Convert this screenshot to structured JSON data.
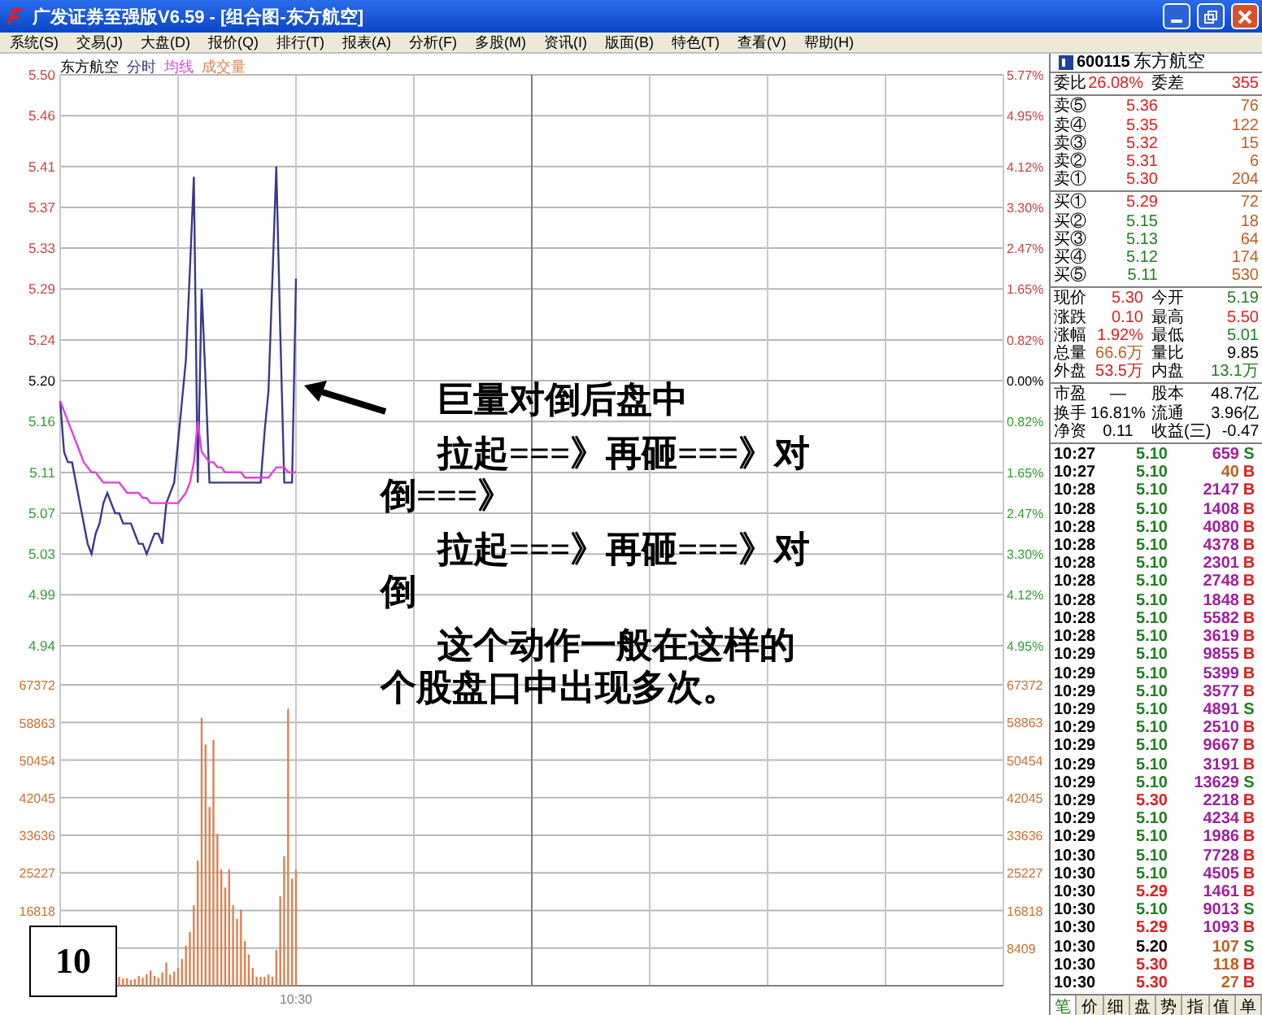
{
  "window": {
    "title": "广发证券至强版V6.59 - [组合图-东方航空]"
  },
  "menu": [
    "系统(S)",
    "交易(J)",
    "大盘(D)",
    "报价(Q)",
    "排行(T)",
    "报表(A)",
    "分析(F)",
    "多股(M)",
    "资讯(I)",
    "版面(B)",
    "特色(T)",
    "查看(V)",
    "帮助(H)"
  ],
  "chart": {
    "stock_label": "东方航空",
    "price_chart": {
      "chart_data": {
        "type": "line",
        "grid": true,
        "ylim": [
          4.94,
          5.5
        ],
        "yticks": [
          {
            "value": 5.5,
            "label": "5.50"
          },
          {
            "value": 5.46,
            "label": "5.46"
          },
          {
            "value": 5.41,
            "label": "5.41"
          },
          {
            "value": 5.37,
            "label": "5.37"
          },
          {
            "value": 5.33,
            "label": "5.33"
          },
          {
            "value": 5.29,
            "label": "5.29"
          },
          {
            "value": 5.24,
            "label": "5.24"
          },
          {
            "value": 5.2,
            "label": "5.20"
          },
          {
            "value": 5.16,
            "label": "5.16"
          },
          {
            "value": 5.11,
            "label": "5.11"
          },
          {
            "value": 5.07,
            "label": "5.07"
          },
          {
            "value": 5.03,
            "label": "5.03"
          },
          {
            "value": 4.99,
            "label": "4.99"
          },
          {
            "value": 4.94,
            "label": "4.94"
          }
        ],
        "categories": [
          null,
          null,
          null,
          null,
          null,
          null,
          null,
          null,
          null,
          null,
          null,
          null,
          null,
          null,
          null,
          null,
          null,
          null,
          null,
          null,
          null,
          null,
          null,
          null,
          null,
          null,
          null,
          null,
          null,
          null,
          null,
          null,
          null,
          null,
          null,
          null,
          null,
          null,
          null,
          null,
          null,
          null,
          null,
          null,
          null,
          null,
          null,
          null,
          null,
          null,
          null,
          null,
          null,
          null,
          null,
          null,
          null,
          null,
          null,
          null,
          null,
          null,
          null,
          null,
          null,
          null,
          null,
          null,
          null,
          null,
          null,
          null,
          null,
          null,
          null,
          null,
          null,
          null,
          null,
          null,
          null,
          null,
          null,
          null,
          null,
          null,
          null,
          null,
          null,
          null,
          null,
          null,
          null,
          null,
          null,
          null,
          null,
          null,
          null,
          null,
          null,
          null,
          null,
          null,
          null,
          null,
          null,
          null,
          null,
          null,
          null,
          null,
          null,
          null,
          null,
          null,
          null,
          null,
          null,
          null,
          null,
          null,
          null,
          null,
          null,
          null,
          null,
          null,
          null,
          null,
          null,
          null,
          null,
          null,
          null,
          null,
          null,
          null,
          null,
          null,
          null,
          null,
          null,
          null,
          null,
          null,
          null,
          null,
          null,
          null,
          null,
          null,
          null,
          null,
          null,
          null,
          null,
          null,
          null,
          null,
          null,
          null,
          null,
          null,
          null,
          null,
          null,
          null,
          null,
          null,
          null,
          null,
          null,
          null,
          null,
          null,
          null,
          null,
          null,
          null,
          null,
          null,
          null,
          null,
          null,
          null,
          null,
          null,
          null,
          null,
          null,
          null,
          null,
          null,
          null,
          null,
          null,
          null,
          null,
          null,
          null,
          null,
          null,
          null,
          null,
          null,
          null,
          null,
          null,
          null,
          null,
          null,
          null,
          null,
          null,
          null,
          null,
          null,
          null,
          null,
          null,
          null,
          null,
          null,
          null,
          null,
          null,
          null,
          null,
          null,
          null,
          null,
          null,
          null,
          null,
          null,
          null,
          null,
          null,
          null,
          null
        ],
        "series": [
          {
            "name": "分时",
            "color": "#3a3a8c",
            "values": [
              5.18,
              5.13,
              5.12,
              5.12,
              5.1,
              5.08,
              5.06,
              5.04,
              5.03,
              5.05,
              5.06,
              5.08,
              5.09,
              5.08,
              5.07,
              5.07,
              5.06,
              5.06,
              5.06,
              5.05,
              5.04,
              5.04,
              5.03,
              5.04,
              5.05,
              5.05,
              5.04,
              5.08,
              5.09,
              5.1,
              5.14,
              5.18,
              5.22,
              5.31,
              5.4,
              5.1,
              5.29,
              5.2,
              5.1,
              5.1,
              5.1,
              5.1,
              5.1,
              5.1,
              5.1,
              5.1,
              5.1,
              5.1,
              5.1,
              5.1,
              5.1,
              5.1,
              5.15,
              5.19,
              5.3,
              5.41,
              5.25,
              5.1,
              5.1,
              5.1,
              5.3,
              null,
              null,
              null,
              null,
              null,
              null,
              null,
              null,
              null,
              null,
              null,
              null,
              null,
              null,
              null,
              null,
              null,
              null,
              null,
              null,
              null,
              null,
              null,
              null,
              null,
              null,
              null,
              null,
              null,
              null,
              null,
              null,
              null,
              null,
              null,
              null,
              null,
              null,
              null,
              null,
              null,
              null,
              null,
              null,
              null,
              null,
              null,
              null,
              null,
              null,
              null,
              null,
              null,
              null,
              null,
              null,
              null,
              null,
              null,
              null,
              null,
              null,
              null,
              null,
              null,
              null,
              null,
              null,
              null,
              null,
              null,
              null,
              null,
              null,
              null,
              null,
              null,
              null,
              null,
              null,
              null,
              null,
              null,
              null,
              null,
              null,
              null,
              null,
              null,
              null,
              null,
              null,
              null,
              null,
              null,
              null,
              null,
              null,
              null,
              null,
              null,
              null,
              null,
              null,
              null,
              null,
              null,
              null,
              null,
              null,
              null,
              null,
              null,
              null,
              null,
              null,
              null,
              null,
              null,
              null,
              null,
              null,
              null,
              null,
              null,
              null,
              null,
              null,
              null,
              null,
              null,
              null,
              null,
              null,
              null,
              null,
              null,
              null,
              null,
              null,
              null,
              null,
              null,
              null,
              null,
              null,
              null,
              null,
              null,
              null,
              null,
              null,
              null,
              null,
              null,
              null,
              null,
              null,
              null,
              null,
              null,
              null,
              null,
              null,
              null,
              null,
              null,
              null,
              null,
              null,
              null,
              null,
              null,
              null,
              null,
              null,
              null,
              null,
              null,
              null
            ]
          },
          {
            "name": "均线",
            "color": "#e040e0",
            "values": [
              5.18,
              5.17,
              5.16,
              5.15,
              5.14,
              5.13,
              5.12,
              5.115,
              5.11,
              5.11,
              5.105,
              5.1,
              5.1,
              5.1,
              5.1,
              5.1,
              5.095,
              5.09,
              5.09,
              5.09,
              5.09,
              5.085,
              5.085,
              5.08,
              5.08,
              5.08,
              5.08,
              5.08,
              5.08,
              5.08,
              5.08,
              5.085,
              5.09,
              5.1,
              5.12,
              5.16,
              5.13,
              5.125,
              5.12,
              5.12,
              5.115,
              5.115,
              5.11,
              5.11,
              5.11,
              5.11,
              5.11,
              5.105,
              5.105,
              5.105,
              5.105,
              5.105,
              5.105,
              5.105,
              5.11,
              5.115,
              5.115,
              5.115,
              5.11,
              5.11,
              5.11,
              null,
              null,
              null,
              null,
              null,
              null,
              null,
              null,
              null,
              null,
              null,
              null,
              null,
              null,
              null,
              null,
              null,
              null,
              null,
              null,
              null,
              null,
              null,
              null,
              null,
              null,
              null,
              null,
              null,
              null,
              null,
              null,
              null,
              null,
              null,
              null,
              null,
              null,
              null,
              null,
              null,
              null,
              null,
              null,
              null,
              null,
              null,
              null,
              null,
              null,
              null,
              null,
              null,
              null,
              null,
              null,
              null,
              null,
              null,
              null,
              null,
              null,
              null,
              null,
              null,
              null,
              null,
              null,
              null,
              null,
              null,
              null,
              null,
              null,
              null,
              null,
              null,
              null,
              null,
              null,
              null,
              null,
              null,
              null,
              null,
              null,
              null,
              null,
              null,
              null,
              null,
              null,
              null,
              null,
              null,
              null,
              null,
              null,
              null,
              null,
              null,
              null,
              null,
              null,
              null,
              null,
              null,
              null,
              null,
              null,
              null,
              null,
              null,
              null,
              null,
              null,
              null,
              null,
              null,
              null,
              null,
              null,
              null,
              null,
              null,
              null,
              null,
              null,
              null,
              null,
              null,
              null,
              null,
              null,
              null,
              null,
              null,
              null,
              null,
              null,
              null,
              null,
              null,
              null,
              null,
              null,
              null,
              null,
              null,
              null,
              null,
              null,
              null,
              null,
              null,
              null,
              null,
              null,
              null,
              null,
              null,
              null,
              null,
              null,
              null,
              null,
              null,
              null,
              null,
              null,
              null,
              null,
              null,
              null,
              null,
              null,
              null,
              null,
              null,
              null
            ]
          }
        ]
      },
      "right_axis_labels": [
        {
          "text": "5.77%",
          "color": "#d04040"
        },
        {
          "text": "4.95%",
          "color": "#d04040"
        },
        {
          "text": "4.12%",
          "color": "#d04040"
        },
        {
          "text": "3.30%",
          "color": "#d04040"
        },
        {
          "text": "2.47%",
          "color": "#d04040"
        },
        {
          "text": "1.65%",
          "color": "#d04040"
        },
        {
          "text": "0.82%",
          "color": "#d04040"
        },
        {
          "text": "0.00%",
          "color": "#000000"
        },
        {
          "text": "0.82%",
          "color": "#30a030"
        },
        {
          "text": "1.65%",
          "color": "#30a030"
        },
        {
          "text": "2.47%",
          "color": "#30a030"
        },
        {
          "text": "3.30%",
          "color": "#30a030"
        },
        {
          "text": "4.12%",
          "color": "#30a030"
        },
        {
          "text": "4.95%",
          "color": "#30a030"
        }
      ]
    },
    "volume_chart": {
      "chart_data": {
        "type": "bar",
        "grid": true,
        "ylim": [
          0,
          67372
        ],
        "yticks": [
          {
            "value": 67372,
            "label": "67372"
          },
          {
            "value": 58863,
            "label": "58863"
          },
          {
            "value": 50454,
            "label": "50454"
          },
          {
            "value": 42045,
            "label": "42045"
          },
          {
            "value": 33636,
            "label": "33636"
          },
          {
            "value": 25227,
            "label": "25227"
          },
          {
            "value": 16818,
            "label": "16818"
          }
        ],
        "categories": [
          null,
          null,
          null,
          null,
          null,
          null,
          null,
          null,
          null,
          null,
          null,
          null,
          null,
          null,
          null,
          null,
          null,
          null,
          null,
          null,
          null,
          null,
          null,
          null,
          null,
          null,
          null,
          null,
          null,
          null,
          null,
          null,
          null,
          null,
          null,
          null,
          null,
          null,
          null,
          null,
          null,
          null,
          null,
          null,
          null,
          null,
          null,
          null,
          null,
          null,
          null,
          null,
          null,
          null,
          null,
          null,
          null,
          null,
          null,
          null,
          "10:30",
          null,
          null,
          null,
          null,
          null,
          null,
          null,
          null,
          null,
          null,
          null,
          null,
          null,
          null,
          null,
          null,
          null,
          null,
          null,
          null,
          null,
          null,
          null,
          null,
          null,
          null,
          null,
          null,
          null,
          null,
          null,
          null,
          null,
          null,
          null,
          null,
          null,
          null,
          null,
          null,
          null,
          null,
          null,
          null,
          null,
          null,
          null,
          null,
          null,
          null,
          null,
          null,
          null,
          null,
          null,
          null,
          null,
          null,
          null,
          null,
          null,
          null,
          null,
          null,
          null,
          null,
          null,
          null,
          null,
          null,
          null,
          null,
          null,
          null,
          null,
          null,
          null,
          null,
          null,
          null,
          null,
          null,
          null,
          null,
          null,
          null,
          null,
          null,
          null,
          null,
          null,
          null,
          null,
          null,
          null,
          null,
          null,
          null,
          null,
          null,
          null,
          null,
          null,
          null,
          null,
          null,
          null,
          null,
          null,
          null,
          null,
          null,
          null,
          null,
          null,
          null,
          null,
          null,
          null,
          null,
          null,
          null,
          null,
          null,
          null,
          null,
          null,
          null,
          null,
          null,
          null,
          null,
          null,
          null,
          null,
          null,
          null,
          null,
          null,
          null,
          null,
          null,
          null,
          null,
          null,
          null,
          null,
          null,
          null,
          null,
          null,
          null,
          null,
          null,
          null,
          null,
          null,
          null,
          null,
          null,
          null,
          null,
          null,
          null,
          null,
          null,
          null,
          null,
          null,
          null,
          null,
          null,
          null,
          null,
          null,
          null,
          null,
          null,
          null,
          null
        ],
        "series": [
          {
            "name": "成交量",
            "color": "#e08050",
            "values": [
              null,
              null,
              null,
              null,
              null,
              null,
              null,
              null,
              null,
              null,
              null,
              null,
              null,
              null,
              null,
              2000,
              1600,
              1700,
              1300,
              1500,
              2200,
              1800,
              2600,
              3400,
              2200,
              1800,
              3000,
              5200,
              2500,
              3200,
              4000,
              6000,
              9000,
              12000,
              18000,
              28000,
              60000,
              54000,
              40000,
              55000,
              34000,
              26000,
              22000,
              26000,
              18000,
              15000,
              17000,
              10000,
              7000,
              4000,
              2000,
              2000,
              2000,
              2500,
              2000,
              8000,
              20000,
              29000,
              62000,
              24000,
              26000,
              null,
              null,
              null,
              null,
              null,
              null,
              null,
              null,
              null,
              null,
              null,
              null,
              null,
              null,
              null,
              null,
              null,
              null,
              null,
              null,
              null,
              null,
              null,
              null,
              null,
              null,
              null,
              null,
              null,
              null,
              null,
              null,
              null,
              null,
              null,
              null,
              null,
              null,
              null,
              null,
              null,
              null,
              null,
              null,
              null,
              null,
              null,
              null,
              null,
              null,
              null,
              null,
              null,
              null,
              null,
              null,
              null,
              null,
              null,
              null,
              null,
              null,
              null,
              null,
              null,
              null,
              null,
              null,
              null,
              null,
              null,
              null,
              null,
              null,
              null,
              null,
              null,
              null,
              null,
              null,
              null,
              null,
              null,
              null,
              null,
              null,
              null,
              null,
              null,
              null,
              null,
              null,
              null,
              null,
              null,
              null,
              null,
              null,
              null,
              null,
              null,
              null,
              null,
              null,
              null,
              null,
              null,
              null,
              null,
              null,
              null,
              null,
              null,
              null,
              null,
              null,
              null,
              null,
              null,
              null,
              null,
              null,
              null,
              null,
              null,
              null,
              null,
              null,
              null,
              null,
              null,
              null,
              null,
              null,
              null,
              null,
              null,
              null,
              null,
              null,
              null,
              null,
              null,
              null,
              null,
              null,
              null,
              null,
              null,
              null,
              null,
              null,
              null,
              null,
              null,
              null,
              null,
              null,
              null,
              null,
              null,
              null,
              null,
              null,
              null,
              null,
              null,
              null,
              null,
              null,
              null,
              null,
              null,
              null,
              null,
              null,
              null,
              null,
              null,
              null
            ]
          }
        ]
      },
      "right_axis_labels": [
        "67372",
        "58863",
        "50454",
        "42045",
        "33636",
        "25227",
        "16818",
        "8409"
      ]
    }
  },
  "annotation": {
    "paragraphs": [
      "巨量对倒后盘中",
      "拉起===》再砸===》对倒===》",
      "拉起===》再砸===》对倒",
      "这个动作一般在这样的个股盘口中出现多次。"
    ]
  },
  "slide_number": "10",
  "quote": {
    "code": "600115",
    "name": "东方航空",
    "ratio": [
      {
        "label": "委比",
        "value": "26.08%",
        "color": "#e02020"
      },
      {
        "label": "委差",
        "value": "355",
        "color": "#e02020"
      }
    ],
    "asks": [
      {
        "label": "卖⑤",
        "price": "5.36",
        "volume": "76",
        "color": "#e02020"
      },
      {
        "label": "卖④",
        "price": "5.35",
        "volume": "122",
        "color": "#e02020"
      },
      {
        "label": "卖③",
        "price": "5.32",
        "volume": "15",
        "color": "#e02020"
      },
      {
        "label": "卖②",
        "price": "5.31",
        "volume": "6",
        "color": "#e02020"
      },
      {
        "label": "卖①",
        "price": "5.30",
        "volume": "204",
        "color": "#e02020"
      }
    ],
    "bids": [
      {
        "label": "买①",
        "price": "5.29",
        "volume": "72",
        "color": "#e02020"
      },
      {
        "label": "买②",
        "price": "5.15",
        "volume": "18",
        "color": "#208020"
      },
      {
        "label": "买③",
        "price": "5.13",
        "volume": "64",
        "color": "#208020"
      },
      {
        "label": "买④",
        "price": "5.12",
        "volume": "174",
        "color": "#208020"
      },
      {
        "label": "买⑤",
        "price": "5.11",
        "volume": "530",
        "color": "#208020"
      }
    ],
    "stats": [
      {
        "label": "现价",
        "value": "5.30",
        "color": "#e02020"
      },
      {
        "label": "今开",
        "value": "5.19",
        "color": "#208020"
      },
      {
        "label": "涨跌",
        "value": "0.10",
        "color": "#e02020"
      },
      {
        "label": "最高",
        "value": "5.50",
        "color": "#e02020"
      },
      {
        "label": "涨幅",
        "value": "1.92%",
        "color": "#e02020"
      },
      {
        "label": "最低",
        "value": "5.01",
        "color": "#208020"
      },
      {
        "label": "总量",
        "value": "66.6万",
        "color": "#c06020"
      },
      {
        "label": "量比",
        "value": "9.85",
        "color": "#000000"
      },
      {
        "label": "外盘",
        "value": "53.5万",
        "color": "#e02020"
      },
      {
        "label": "内盘",
        "value": "13.1万",
        "color": "#208020"
      }
    ],
    "fundamentals": [
      {
        "label": "市盈",
        "value": "—"
      },
      {
        "label": "股本",
        "value": "48.7亿"
      },
      {
        "label": "换手",
        "value": "16.81%"
      },
      {
        "label": "流通",
        "value": "3.96亿"
      },
      {
        "label": "净资",
        "value": "0.11"
      },
      {
        "label": "收益(三)",
        "value": "-0.47"
      }
    ],
    "ticks": [
      {
        "time": "10:27",
        "price": {
          "text": "5.10",
          "color": "#208020"
        },
        "volume": {
          "text": "659",
          "color": "#a020a0"
        },
        "side": {
          "text": "S",
          "color": "#208020"
        }
      },
      {
        "time": "10:27",
        "price": {
          "text": "5.10",
          "color": "#208020"
        },
        "volume": {
          "text": "40",
          "color": "#c06020"
        },
        "side": {
          "text": "B",
          "color": "#e02020"
        }
      },
      {
        "time": "10:28",
        "price": {
          "text": "5.10",
          "color": "#208020"
        },
        "volume": {
          "text": "2147",
          "color": "#a020a0"
        },
        "side": {
          "text": "B",
          "color": "#e02020"
        }
      },
      {
        "time": "10:28",
        "price": {
          "text": "5.10",
          "color": "#208020"
        },
        "volume": {
          "text": "1408",
          "color": "#a020a0"
        },
        "side": {
          "text": "B",
          "color": "#e02020"
        }
      },
      {
        "time": "10:28",
        "price": {
          "text": "5.10",
          "color": "#208020"
        },
        "volume": {
          "text": "4080",
          "color": "#a020a0"
        },
        "side": {
          "text": "B",
          "color": "#e02020"
        }
      },
      {
        "time": "10:28",
        "price": {
          "text": "5.10",
          "color": "#208020"
        },
        "volume": {
          "text": "4378",
          "color": "#a020a0"
        },
        "side": {
          "text": "B",
          "color": "#e02020"
        }
      },
      {
        "time": "10:28",
        "price": {
          "text": "5.10",
          "color": "#208020"
        },
        "volume": {
          "text": "2301",
          "color": "#a020a0"
        },
        "side": {
          "text": "B",
          "color": "#e02020"
        }
      },
      {
        "time": "10:28",
        "price": {
          "text": "5.10",
          "color": "#208020"
        },
        "volume": {
          "text": "2748",
          "color": "#a020a0"
        },
        "side": {
          "text": "B",
          "color": "#e02020"
        }
      },
      {
        "time": "10:28",
        "price": {
          "text": "5.10",
          "color": "#208020"
        },
        "volume": {
          "text": "1848",
          "color": "#a020a0"
        },
        "side": {
          "text": "B",
          "color": "#e02020"
        }
      },
      {
        "time": "10:28",
        "price": {
          "text": "5.10",
          "color": "#208020"
        },
        "volume": {
          "text": "5582",
          "color": "#a020a0"
        },
        "side": {
          "text": "B",
          "color": "#e02020"
        }
      },
      {
        "time": "10:28",
        "price": {
          "text": "5.10",
          "color": "#208020"
        },
        "volume": {
          "text": "3619",
          "color": "#a020a0"
        },
        "side": {
          "text": "B",
          "color": "#e02020"
        }
      },
      {
        "time": "10:29",
        "price": {
          "text": "5.10",
          "color": "#208020"
        },
        "volume": {
          "text": "9855",
          "color": "#a020a0"
        },
        "side": {
          "text": "B",
          "color": "#e02020"
        }
      },
      {
        "time": "10:29",
        "price": {
          "text": "5.10",
          "color": "#208020"
        },
        "volume": {
          "text": "5399",
          "color": "#a020a0"
        },
        "side": {
          "text": "B",
          "color": "#e02020"
        }
      },
      {
        "time": "10:29",
        "price": {
          "text": "5.10",
          "color": "#208020"
        },
        "volume": {
          "text": "3577",
          "color": "#a020a0"
        },
        "side": {
          "text": "B",
          "color": "#e02020"
        }
      },
      {
        "time": "10:29",
        "price": {
          "text": "5.10",
          "color": "#208020"
        },
        "volume": {
          "text": "4891",
          "color": "#a020a0"
        },
        "side": {
          "text": "S",
          "color": "#208020"
        }
      },
      {
        "time": "10:29",
        "price": {
          "text": "5.10",
          "color": "#208020"
        },
        "volume": {
          "text": "2510",
          "color": "#a020a0"
        },
        "side": {
          "text": "B",
          "color": "#e02020"
        }
      },
      {
        "time": "10:29",
        "price": {
          "text": "5.10",
          "color": "#208020"
        },
        "volume": {
          "text": "9667",
          "color": "#a020a0"
        },
        "side": {
          "text": "B",
          "color": "#e02020"
        }
      },
      {
        "time": "10:29",
        "price": {
          "text": "5.10",
          "color": "#208020"
        },
        "volume": {
          "text": "3191",
          "color": "#a020a0"
        },
        "side": {
          "text": "B",
          "color": "#e02020"
        }
      },
      {
        "time": "10:29",
        "price": {
          "text": "5.10",
          "color": "#208020"
        },
        "volume": {
          "text": "13629",
          "color": "#a020a0"
        },
        "side": {
          "text": "S",
          "color": "#208020"
        }
      },
      {
        "time": "10:29",
        "price": {
          "text": "5.30",
          "color": "#e02020"
        },
        "volume": {
          "text": "2218",
          "color": "#a020a0"
        },
        "side": {
          "text": "B",
          "color": "#e02020"
        }
      },
      {
        "time": "10:29",
        "price": {
          "text": "5.10",
          "color": "#208020"
        },
        "volume": {
          "text": "4234",
          "color": "#a020a0"
        },
        "side": {
          "text": "B",
          "color": "#e02020"
        }
      },
      {
        "time": "10:29",
        "price": {
          "text": "5.10",
          "color": "#208020"
        },
        "volume": {
          "text": "1986",
          "color": "#a020a0"
        },
        "side": {
          "text": "B",
          "color": "#e02020"
        }
      },
      {
        "time": "10:30",
        "price": {
          "text": "5.10",
          "color": "#208020"
        },
        "volume": {
          "text": "7728",
          "color": "#a020a0"
        },
        "side": {
          "text": "B",
          "color": "#e02020"
        }
      },
      {
        "time": "10:30",
        "price": {
          "text": "5.10",
          "color": "#208020"
        },
        "volume": {
          "text": "4505",
          "color": "#a020a0"
        },
        "side": {
          "text": "B",
          "color": "#e02020"
        }
      },
      {
        "time": "10:30",
        "price": {
          "text": "5.29",
          "color": "#e02020"
        },
        "volume": {
          "text": "1461",
          "color": "#a020a0"
        },
        "side": {
          "text": "B",
          "color": "#e02020"
        }
      },
      {
        "time": "10:30",
        "price": {
          "text": "5.10",
          "color": "#208020"
        },
        "volume": {
          "text": "9013",
          "color": "#a020a0"
        },
        "side": {
          "text": "S",
          "color": "#208020"
        }
      },
      {
        "time": "10:30",
        "price": {
          "text": "5.29",
          "color": "#e02020"
        },
        "volume": {
          "text": "1093",
          "color": "#a020a0"
        },
        "side": {
          "text": "B",
          "color": "#e02020"
        }
      },
      {
        "time": "10:30",
        "price": {
          "text": "5.20",
          "color": "#000000"
        },
        "volume": {
          "text": "107",
          "color": "#c06020"
        },
        "side": {
          "text": "S",
          "color": "#208020"
        }
      },
      {
        "time": "10:30",
        "price": {
          "text": "5.30",
          "color": "#e02020"
        },
        "volume": {
          "text": "118",
          "color": "#c06020"
        },
        "side": {
          "text": "B",
          "color": "#e02020"
        }
      },
      {
        "time": "10:30",
        "price": {
          "text": "5.30",
          "color": "#e02020"
        },
        "volume": {
          "text": "27",
          "color": "#c06020"
        },
        "side": {
          "text": "B",
          "color": "#e02020"
        }
      }
    ],
    "tabs": [
      {
        "label": "笔",
        "selected": true
      },
      {
        "label": "价",
        "selected": false
      },
      {
        "label": "细",
        "selected": false
      },
      {
        "label": "盘",
        "selected": false
      },
      {
        "label": "势",
        "selected": false
      },
      {
        "label": "指",
        "selected": false
      },
      {
        "label": "值",
        "selected": false
      },
      {
        "label": "单",
        "selected": false
      }
    ]
  }
}
